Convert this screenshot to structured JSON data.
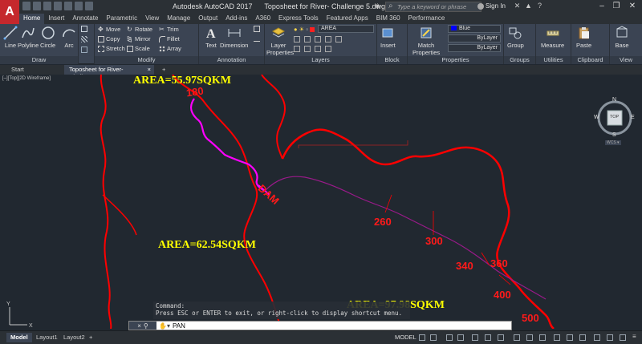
{
  "titlebar": {
    "app_name": "Autodesk AutoCAD 2017",
    "file_title": "Toposheet for River- Challenge 5.dwg",
    "search_placeholder": "Type a keyword or phrase",
    "sign_in": "Sign In"
  },
  "ribbon_tabs": [
    "Home",
    "Insert",
    "Annotate",
    "Parametric",
    "View",
    "Manage",
    "Output",
    "Add-ins",
    "A360",
    "Express Tools",
    "Featured Apps",
    "BIM 360",
    "Performance"
  ],
  "active_ribbon_tab": "Home",
  "ribbon": {
    "draw": {
      "title": "Draw",
      "line": "Line",
      "polyline": "Polyline",
      "circle": "Circle",
      "arc": "Arc"
    },
    "modify": {
      "title": "Modify",
      "move": "Move",
      "rotate": "Rotate",
      "trim": "Trim",
      "copy": "Copy",
      "mirror": "Mirror",
      "fillet": "Fillet",
      "stretch": "Stretch",
      "scale": "Scale",
      "array": "Array"
    },
    "annotation": {
      "title": "Annotation",
      "text": "Text",
      "dimension": "Dimension"
    },
    "layers": {
      "title": "Layers",
      "layer_properties": "Layer Properties",
      "current_layer": "AREA"
    },
    "block": {
      "title": "Block",
      "insert": "Insert"
    },
    "properties": {
      "title": "Properties",
      "match_properties": "Match Properties",
      "color": "Blue",
      "linetype": "ByLayer",
      "lineweight": "ByLayer"
    },
    "groups": {
      "title": "Groups",
      "group": "Group"
    },
    "utilities": {
      "title": "Utilities",
      "measure": "Measure"
    },
    "clipboard": {
      "title": "Clipboard",
      "paste": "Paste"
    },
    "view": {
      "title": "View",
      "base": "Base"
    }
  },
  "file_tabs": {
    "start": "Start",
    "active": "Toposheet for River- Challenge 5*"
  },
  "viewport_label": "[–][Top][2D Wireframe]",
  "viewcube": {
    "top": "TOP",
    "n": "N",
    "s": "S",
    "e": "E",
    "w": "W",
    "wcs": "WCS ▾"
  },
  "map_labels": {
    "area1": "AREA=55.97SQKM",
    "area2": "AREA=62.54SQKM",
    "area3": "AREA=97.98SQKM",
    "dam": "DAM",
    "c180": "180",
    "c260": "260",
    "c300": "300",
    "c340": "340",
    "c360": "360",
    "c400": "400",
    "c500": "500"
  },
  "command": {
    "history_1": "Command:",
    "history_2": "Press ESC or ENTER to exit, or right-click to display shortcut menu.",
    "current": "PAN"
  },
  "status": {
    "model_tab": "Model",
    "layout1": "Layout1",
    "layout2": "Layout2",
    "model_space": "MODEL"
  },
  "colors": {
    "background": "#212830",
    "catchment": "#ff0000",
    "river": "#ff00ff",
    "area_label": "#ffff00",
    "autocad_red": "#c5282d"
  }
}
